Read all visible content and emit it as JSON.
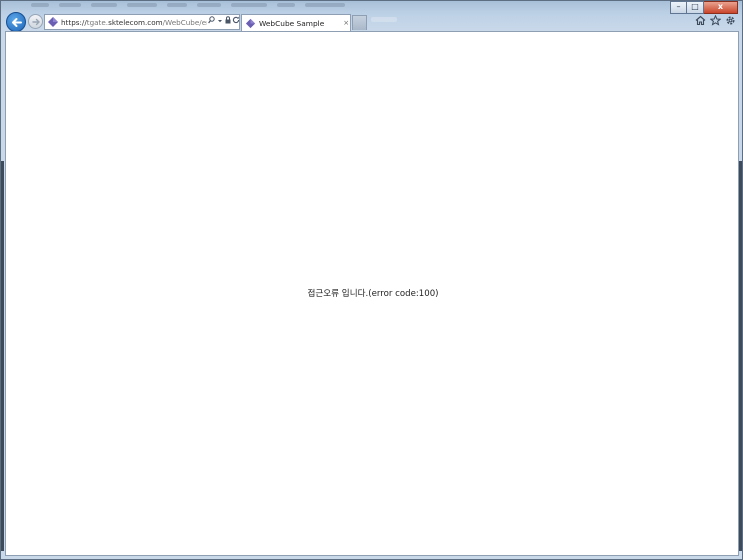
{
  "browser": {
    "url": {
      "scheme": "https://",
      "host_pre": "tgate.",
      "host": "sktelecom.com",
      "path": "/WebCube/error.htm"
    },
    "active_tab": {
      "title": "WebCube Sample",
      "close_glyph": "×"
    },
    "caption": {
      "minimize": "–",
      "maximize": "□",
      "close": "x"
    },
    "icons": {
      "back": "back-arrow-icon",
      "forward": "forward-arrow-icon",
      "site": "webcube-diamond-icon",
      "search": "search-icon",
      "dropdown": "dropdown-arrow-icon",
      "lock": "lock-icon",
      "refresh": "refresh-icon",
      "home": "home-icon",
      "favorites": "favorites-star-icon",
      "tools": "tools-gear-icon"
    },
    "colors": {
      "accent": "#1b63b8",
      "site_icon": "#6b5fb3",
      "close_button": "#c8452b"
    }
  },
  "page": {
    "message": "접근오류 입니다.(error code:100)"
  }
}
